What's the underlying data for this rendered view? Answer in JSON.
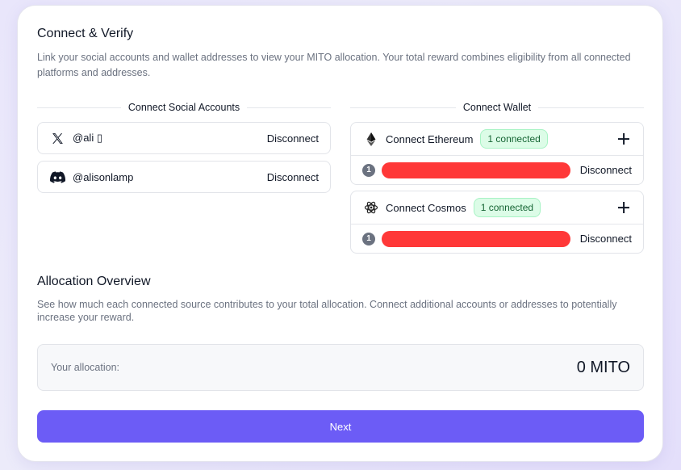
{
  "connect": {
    "title": "Connect & Verify",
    "description": "Link your social accounts and wallet addresses to view your MITO allocation. Your total reward combines eligibility from all connected platforms and addresses."
  },
  "social": {
    "heading": "Connect Social Accounts",
    "accounts": [
      {
        "icon": "x-icon",
        "handle": "@ali ▯",
        "action": "Disconnect"
      },
      {
        "icon": "discord-icon",
        "handle": "@alisonlamp",
        "action": "Disconnect"
      }
    ]
  },
  "wallet": {
    "heading": "Connect Wallet",
    "chains": [
      {
        "icon": "ethereum-icon",
        "label": "Connect Ethereum",
        "badge": "1 connected",
        "addresses": [
          {
            "index": "1",
            "action": "Disconnect"
          }
        ]
      },
      {
        "icon": "cosmos-icon",
        "label": "Connect Cosmos",
        "badge": "1 connected",
        "addresses": [
          {
            "index": "1",
            "action": "Disconnect"
          }
        ]
      }
    ]
  },
  "allocation": {
    "title": "Allocation Overview",
    "description": "See how much each connected source contributes to your total allocation. Connect additional accounts or addresses to potentially increase your reward.",
    "label": "Your allocation:",
    "value": "0 MITO"
  },
  "next_label": "Next",
  "colors": {
    "accent": "#6c5cf6",
    "badge_bg": "#dcfce7",
    "badge_text": "#166534",
    "redaction": "#ff3838"
  }
}
